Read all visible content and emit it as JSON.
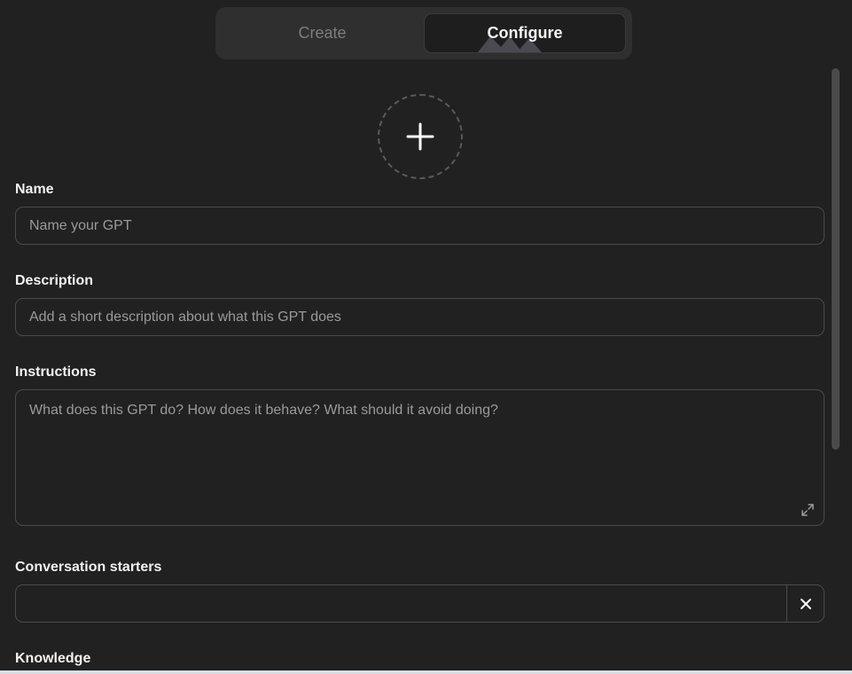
{
  "tabs": {
    "create_label": "Create",
    "configure_label": "Configure",
    "active": "Configure"
  },
  "avatar": {
    "icon": "plus-icon"
  },
  "fields": {
    "name": {
      "label": "Name",
      "value": "",
      "placeholder": "Name your GPT"
    },
    "description": {
      "label": "Description",
      "value": "",
      "placeholder": "Add a short description about what this GPT does"
    },
    "instructions": {
      "label": "Instructions",
      "value": "",
      "placeholder": "What does this GPT do? How does it behave? What should it avoid doing?",
      "expand_icon": "expand-icon"
    },
    "conversation_starters": {
      "label": "Conversation starters",
      "value": "",
      "remove_icon": "close-icon"
    },
    "knowledge": {
      "label": "Knowledge"
    }
  },
  "colors": {
    "background": "#212121",
    "tabs_bg": "#2f2f2f",
    "active_tab_bg": "#1e1e1e",
    "border": "#4b4b4b",
    "text": "#ececec",
    "placeholder": "#9a9a9a"
  }
}
